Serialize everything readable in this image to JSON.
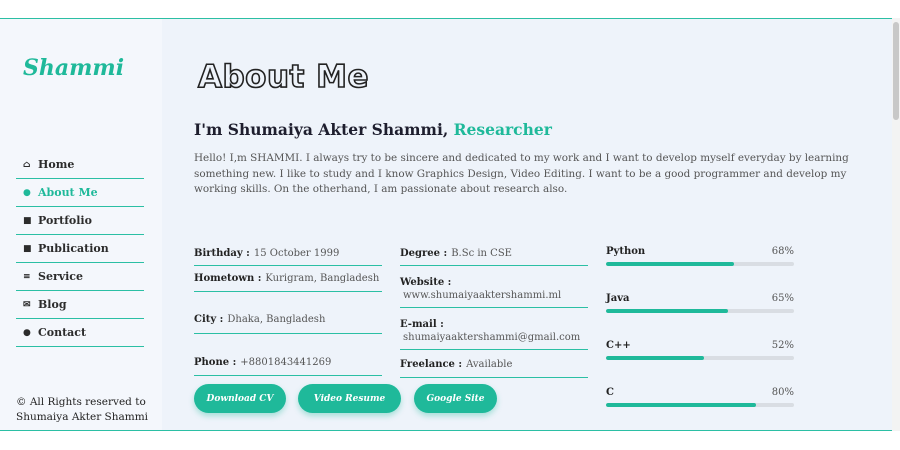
{
  "brand": "Shammi",
  "nav": [
    {
      "label": "Home",
      "icon": "home-icon",
      "glyph": "⌂"
    },
    {
      "label": "About Me",
      "icon": "user-icon",
      "glyph": "●"
    },
    {
      "label": "Portfolio",
      "icon": "briefcase-icon",
      "glyph": "■"
    },
    {
      "label": "Publication",
      "icon": "briefcase-icon",
      "glyph": "■"
    },
    {
      "label": "Service",
      "icon": "list-icon",
      "glyph": "≡"
    },
    {
      "label": "Blog",
      "icon": "envelope-icon",
      "glyph": "✉"
    },
    {
      "label": "Contact",
      "icon": "chat-icon",
      "glyph": "●"
    }
  ],
  "copyright": {
    "line1": "© All Rights reserved to",
    "line2": "Shumaiya Akter Shammi"
  },
  "heading": "About Me",
  "intro": {
    "prefix": "I'm Shumaiya Akter Shammi, ",
    "role": "Researcher"
  },
  "bio": "Hello! I,m SHAMMI. I always try to be sincere and dedicated to my work and I want to develop myself everyday by learning something new. I like to study and I know Graphics Design, Video Editing. I want to be a good programmer and develop my working skills. On the otherhand, I am passionate about research also.",
  "info_left": [
    {
      "label": "Birthday :",
      "value": "15 October 1999"
    },
    {
      "label": "Hometown :",
      "value": "Kurigram, Bangladesh"
    },
    {
      "label": "City :",
      "value": "Dhaka, Bangladesh"
    },
    {
      "label": "Phone :",
      "value": "+8801843441269"
    }
  ],
  "info_right": [
    {
      "label": "Degree :",
      "value": "B.Sc in CSE"
    },
    {
      "label": "Website :",
      "value": "www.shumaiyaaktershammi.ml"
    },
    {
      "label": "E-mail :",
      "value": "shumaiyaaktershammi@gmail.com"
    },
    {
      "label": "Freelance :",
      "value": "Available"
    }
  ],
  "skills": [
    {
      "name": "Python",
      "percent": "68%",
      "level": 0.68
    },
    {
      "name": "Java",
      "percent": "65%",
      "level": 0.65
    },
    {
      "name": "C++",
      "percent": "52%",
      "level": 0.52
    },
    {
      "name": "C",
      "percent": "80%",
      "level": 0.8
    }
  ],
  "buttons": {
    "download_cv": "Download CV",
    "video_resume": "Video Resume",
    "google_site": "Google Site"
  },
  "colors": {
    "accent": "#1fb99a",
    "background": "#eef3fa",
    "sidebar": "#f4f7fc"
  }
}
